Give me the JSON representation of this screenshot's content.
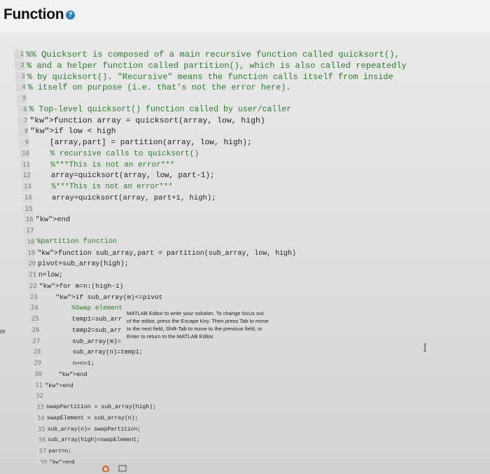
{
  "header": {
    "title": "Function",
    "help_icon": "question-circle-icon"
  },
  "left_fragment": "or",
  "tooltip": {
    "text": "MATLAB Editor to write your solution. To change focus out\nof the editor, press the Escape Key. Then press Tab to move\nto the next field, Shift-Tab to move to the previous field, or\nEnter to return to the MATLAB Editor."
  },
  "code_lines": [
    {
      "n": "1",
      "t": "%% Quicksort is composed of a main recursive function called quicksort(),"
    },
    {
      "n": "2",
      "t": "% and a helper function called partition(), which is also called repeatedly"
    },
    {
      "n": "3",
      "t": "% by quicksort(). \"Recursive\" means the function calls itself from inside"
    },
    {
      "n": "4",
      "t": "% itself on purpose (i.e. that's not the error here)."
    },
    {
      "n": "5",
      "t": ""
    },
    {
      "n": "6",
      "t": "% Top-level quicksort() function called by user/caller"
    },
    {
      "n": "7",
      "t": "function array = quicksort(array, low, high)"
    },
    {
      "n": "8",
      "t": "if low < high"
    },
    {
      "n": "9",
      "t": "    [array,part] = partition(array, low, high);"
    },
    {
      "n": "10",
      "t": "    % recursive calls to quicksort()"
    },
    {
      "n": "11",
      "t": "    %***This is not an error***"
    },
    {
      "n": "12",
      "t": "    array=quicksort(array, low, part-1);"
    },
    {
      "n": "13",
      "t": "    %***This is not an error***"
    },
    {
      "n": "14",
      "t": "    array=quicksort(array, part+1, high);"
    },
    {
      "n": "15",
      "t": ""
    },
    {
      "n": "16",
      "t": "end"
    },
    {
      "n": "17",
      "t": ""
    },
    {
      "n": "18",
      "t": "%partition function"
    },
    {
      "n": "19",
      "t": "function sub_array,part = partition(sub_array, low, high)"
    },
    {
      "n": "20",
      "t": "pivot=sub_array(high);"
    },
    {
      "n": "21",
      "t": "n=low;"
    },
    {
      "n": "22",
      "t": "for m=n:(high-1)"
    },
    {
      "n": "23",
      "t": "    if sub_array(m)<=pivot"
    },
    {
      "n": "24",
      "t": "        %Swap element"
    },
    {
      "n": "25",
      "t": "        temp1=sub_arr"
    },
    {
      "n": "26",
      "t": "        temp2=sub_arr"
    },
    {
      "n": "27",
      "t": "        sub_array(m)="
    },
    {
      "n": "28",
      "t": "        sub_array(n)=temp1;"
    },
    {
      "n": "29",
      "t": "        n=n+1;"
    },
    {
      "n": "30",
      "t": "    end"
    },
    {
      "n": "31",
      "t": "end"
    },
    {
      "n": "32",
      "t": ""
    },
    {
      "n": "33",
      "t": "swapPartition = sub_array(high);"
    },
    {
      "n": "34",
      "t": "swapElement = sub_array(n);"
    },
    {
      "n": "35",
      "t": "sub_array(n)= swapPartition;"
    },
    {
      "n": "36",
      "t": "sub_array(high)=swapElement;"
    },
    {
      "n": "37",
      "t": "part=n;"
    },
    {
      "n": "38",
      "t": "end"
    }
  ]
}
